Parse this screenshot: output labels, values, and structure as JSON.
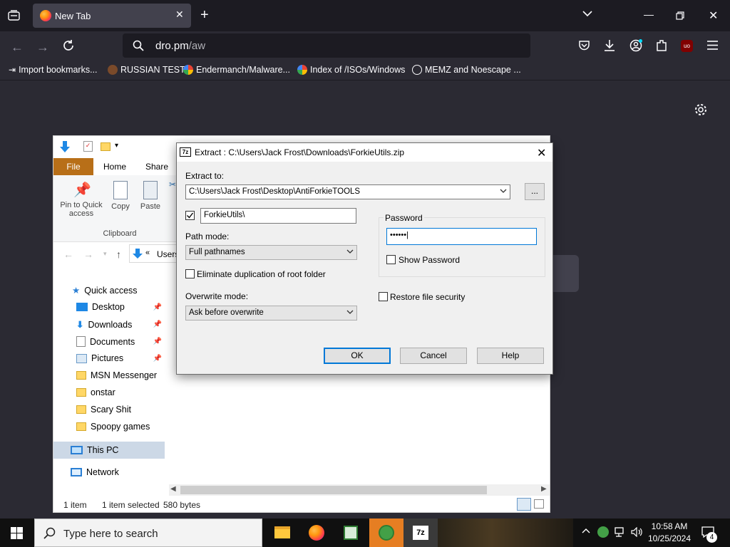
{
  "browser": {
    "tab_title": "New Tab",
    "url_domain": "dro.pm",
    "url_path": "/aw",
    "bookmarks": [
      "Import bookmarks...",
      "RUSSIAN TEST",
      "Endermanch/Malware...",
      "Index of /ISOs/Windows",
      "MEMZ and Noescape ..."
    ],
    "ublock_label": "uo"
  },
  "explorer": {
    "ribbon_tabs": [
      "File",
      "Home",
      "Share"
    ],
    "ribbon_buttons": {
      "pin": "Pin to Quick access",
      "copy": "Copy",
      "paste": "Paste"
    },
    "group_label": "Clipboard",
    "address_text": "Users",
    "nav": {
      "quick_access": "Quick access",
      "pinned": [
        "Desktop",
        "Downloads",
        "Documents",
        "Pictures"
      ],
      "folders": [
        "MSN Messenger",
        "onstar",
        "Scary Shit",
        "Spoopy games"
      ],
      "this_pc": "This PC",
      "network": "Network"
    },
    "status": {
      "items": "1 item",
      "selected": "1 item selected",
      "size": "580 bytes"
    }
  },
  "dialog": {
    "app_badge": "7z",
    "title": "Extract : C:\\Users\\Jack Frost\\Downloads\\ForkieUtils.zip",
    "extract_to_label": "Extract to:",
    "extract_to_value": "C:\\Users\\Jack Frost\\Desktop\\AntiForkieTOOLS",
    "browse_label": "...",
    "subfolder_value": "ForkieUtils\\",
    "path_mode_label": "Path mode:",
    "path_mode_value": "Full pathnames",
    "eliminate_label": "Eliminate duplication of root folder",
    "overwrite_label": "Overwrite mode:",
    "overwrite_value": "Ask before overwrite",
    "password_group": "Password",
    "password_value": "••••••",
    "show_password": "Show Password",
    "restore_security": "Restore file security",
    "ok": "OK",
    "cancel": "Cancel",
    "help": "Help"
  },
  "taskbar": {
    "search_placeholder": "Type here to search",
    "time": "10:58 AM",
    "date": "10/25/2024",
    "notification_count": "4",
    "badge_7z": "7z"
  }
}
